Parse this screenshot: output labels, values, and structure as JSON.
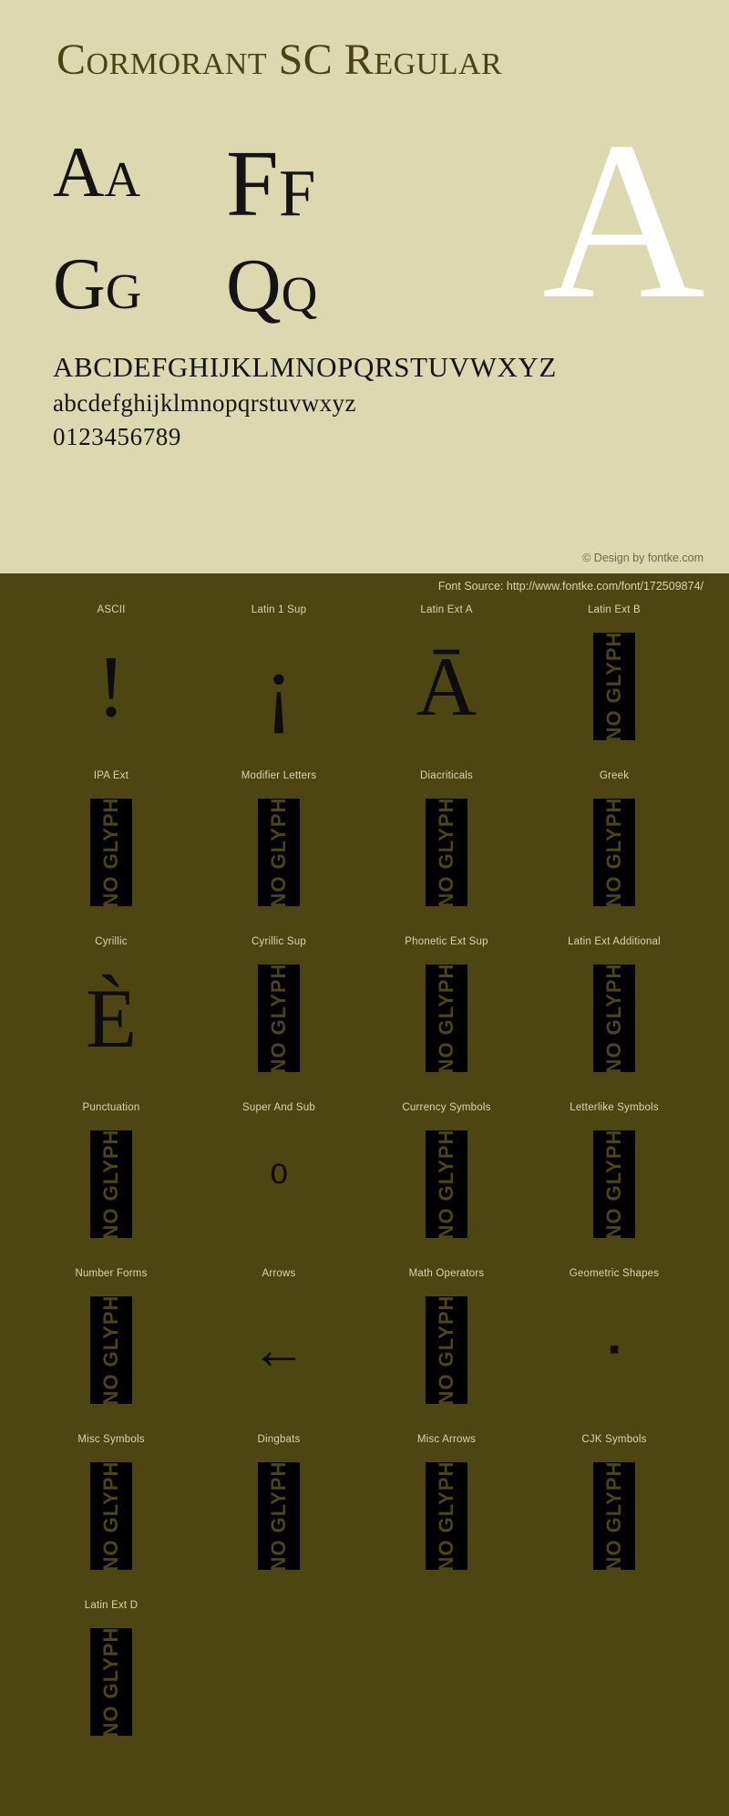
{
  "colors": {
    "light_bg": "#dcd9b0",
    "dark_bg": "#4d4612",
    "title_text": "#4a4312",
    "glyph_black": "#0d0d0d",
    "showcase_white": "#ffffff",
    "label_text": "#d9d5b2",
    "credit_text": "#6f6a4a"
  },
  "header": {
    "title": "Cormorant SC Regular"
  },
  "showcase": {
    "big_letter": "A",
    "pairs": [
      {
        "upper": "A",
        "lower": "a"
      },
      {
        "upper": "F",
        "lower": "f"
      },
      {
        "upper": "G",
        "lower": "g"
      },
      {
        "upper": "Q",
        "lower": "q"
      }
    ]
  },
  "alphabet": {
    "uppercase": "ABCDEFGHIJKLMNOPQRSTUVWXYZ",
    "smallcaps": "abcdefghijklmnopqrstuvwxyz",
    "digits": "0123456789"
  },
  "credit": {
    "copyright": "© Design by fontke.com",
    "source": "Font Source: http://www.fontke.com/font/172509874/"
  },
  "noglyph_label": "NO GLYPH",
  "unicode_blocks": [
    [
      {
        "label": "ASCII",
        "glyph": "!",
        "size": "sz-exclaim",
        "has_glyph": true
      },
      {
        "label": "Latin 1 Sup",
        "glyph": "¡",
        "size": "sz-invexcl",
        "has_glyph": true
      },
      {
        "label": "Latin Ext A",
        "glyph": "Ā",
        "size": "sz-amacron",
        "has_glyph": true
      },
      {
        "label": "Latin Ext B",
        "glyph": "",
        "size": "",
        "has_glyph": false
      }
    ],
    [
      {
        "label": "IPA Ext",
        "glyph": "",
        "size": "",
        "has_glyph": false
      },
      {
        "label": "Modifier Letters",
        "glyph": "",
        "size": "",
        "has_glyph": false
      },
      {
        "label": "Diacriticals",
        "glyph": "",
        "size": "",
        "has_glyph": false
      },
      {
        "label": "Greek",
        "glyph": "",
        "size": "",
        "has_glyph": false
      }
    ],
    [
      {
        "label": "Cyrillic",
        "glyph": "È",
        "size": "sz-egrave",
        "has_glyph": true
      },
      {
        "label": "Cyrillic Sup",
        "glyph": "",
        "size": "",
        "has_glyph": false
      },
      {
        "label": "Phonetic Ext Sup",
        "glyph": "",
        "size": "",
        "has_glyph": false
      },
      {
        "label": "Latin Ext Additional",
        "glyph": "",
        "size": "",
        "has_glyph": false
      }
    ],
    [
      {
        "label": "Punctuation",
        "glyph": "",
        "size": "",
        "has_glyph": false
      },
      {
        "label": "Super And Sub",
        "glyph": "⁰",
        "size": "sz-supzero",
        "has_glyph": true
      },
      {
        "label": "Currency Symbols",
        "glyph": "",
        "size": "",
        "has_glyph": false
      },
      {
        "label": "Letterlike Symbols",
        "glyph": "",
        "size": "",
        "has_glyph": false
      }
    ],
    [
      {
        "label": "Number Forms",
        "glyph": "",
        "size": "",
        "has_glyph": false
      },
      {
        "label": "Arrows",
        "glyph": "←",
        "size": "sz-arrow",
        "has_glyph": true
      },
      {
        "label": "Math Operators",
        "glyph": "",
        "size": "",
        "has_glyph": false
      },
      {
        "label": "Geometric Shapes",
        "glyph": "▪",
        "size": "sz-square",
        "has_glyph": true
      }
    ],
    [
      {
        "label": "Misc Symbols",
        "glyph": "",
        "size": "",
        "has_glyph": false
      },
      {
        "label": "Dingbats",
        "glyph": "",
        "size": "",
        "has_glyph": false
      },
      {
        "label": "Misc Arrows",
        "glyph": "",
        "size": "",
        "has_glyph": false
      },
      {
        "label": "CJK Symbols",
        "glyph": "",
        "size": "",
        "has_glyph": false
      }
    ],
    [
      {
        "label": "Latin Ext D",
        "glyph": "",
        "size": "",
        "has_glyph": false
      }
    ]
  ]
}
